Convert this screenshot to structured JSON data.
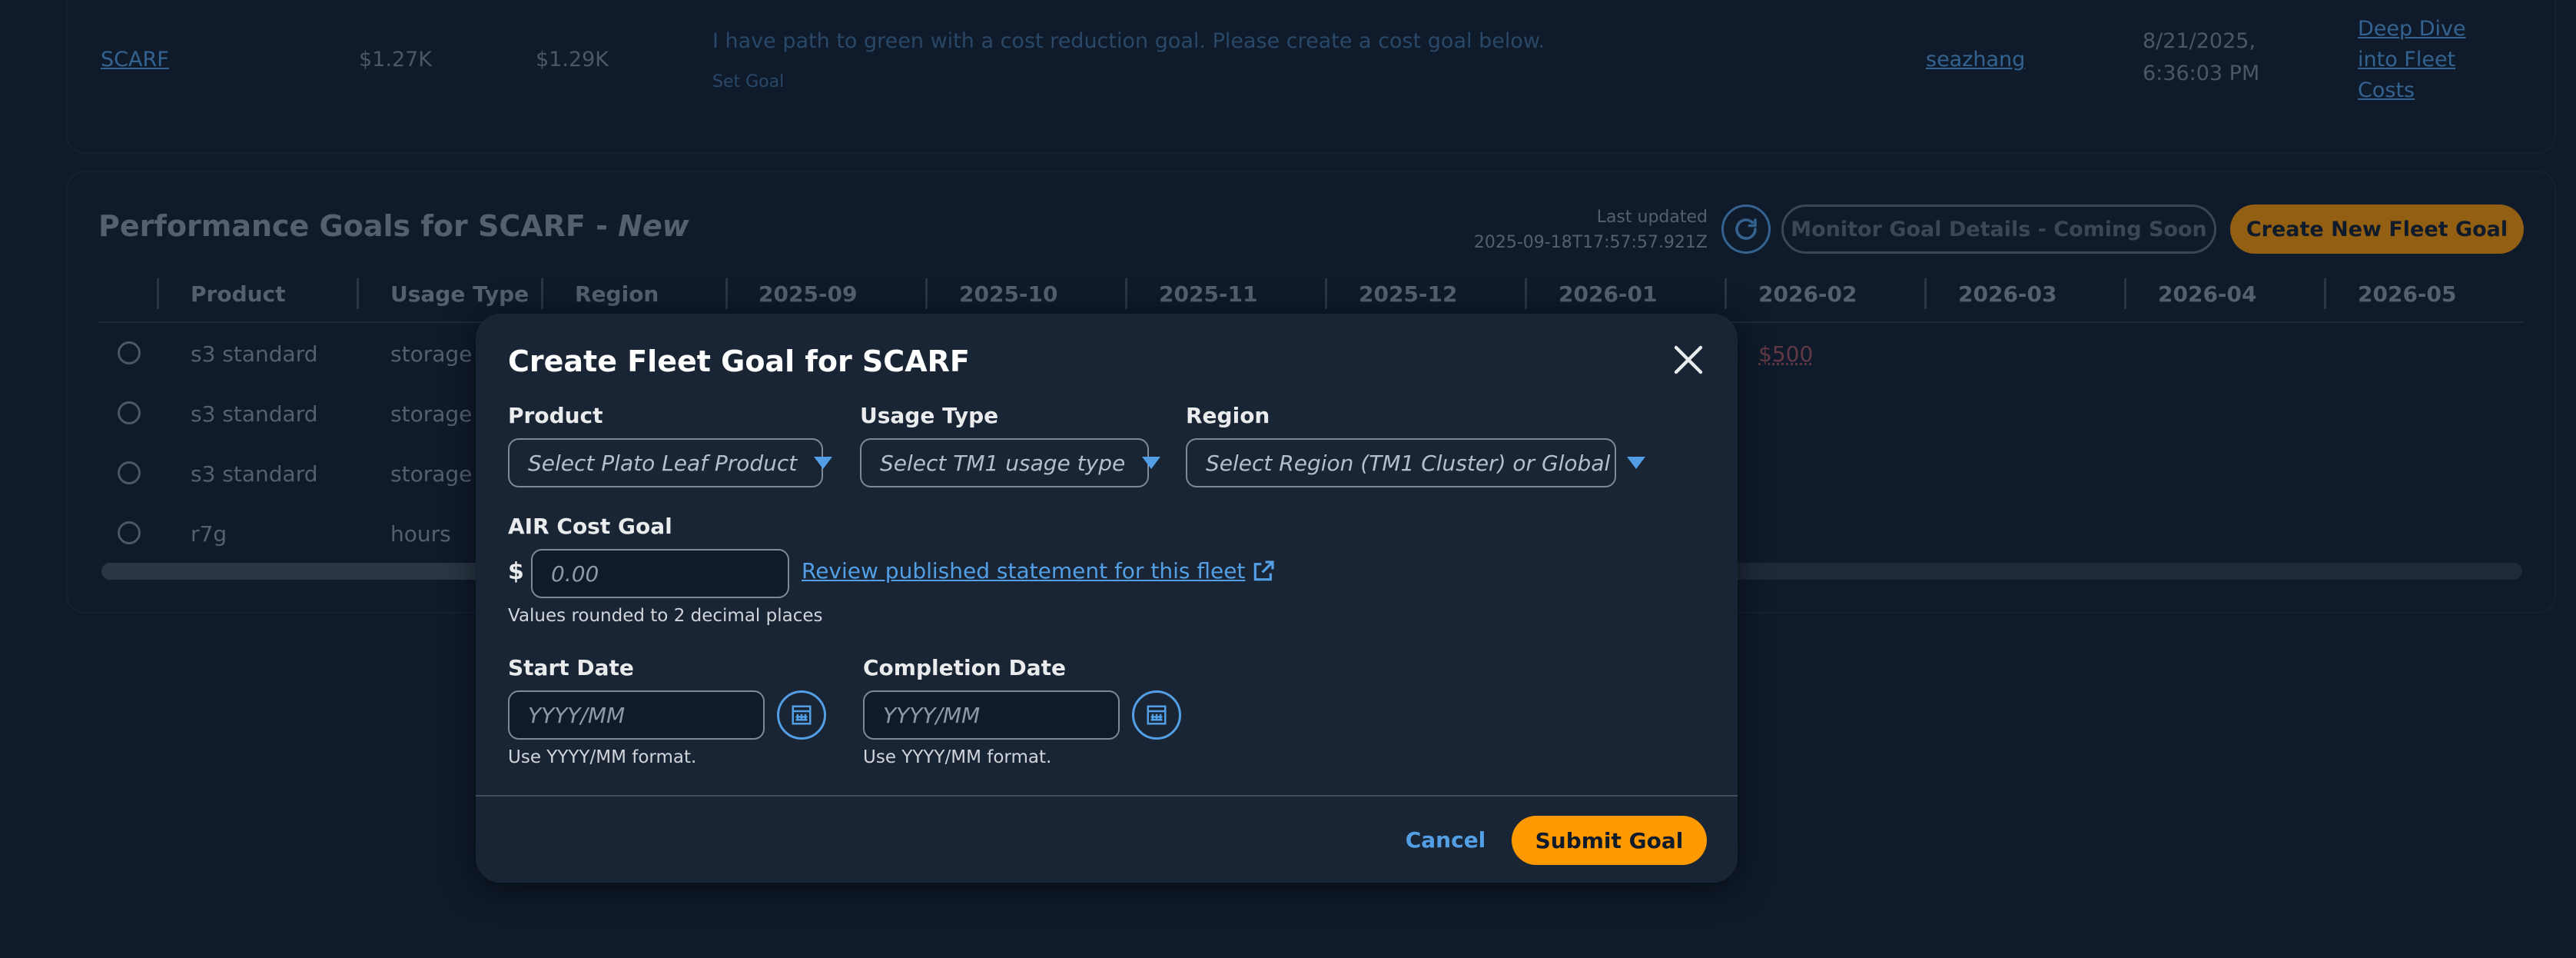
{
  "fleet_row": {
    "name": "SCARF",
    "cost_a": "$1.27K",
    "cost_b": "$1.29K",
    "message": "I have path to green with a cost reduction goal. Please create a cost goal below.",
    "set_goal": "Set Goal",
    "owner": "seazhang",
    "date_line1": "8/21/2025,",
    "date_line2": "6:36:03 PM",
    "deep_dive_1": "Deep Dive",
    "deep_dive_2": "into Fleet",
    "deep_dive_3": "Costs"
  },
  "perf": {
    "title": "Performance Goals for SCARF - ",
    "title_new": "New",
    "last_updated_label": "Last updated",
    "last_updated_value": "2025-09-18T17:57:57.921Z",
    "monitor_label": "Monitor Goal Details - Coming Soon",
    "create_label": "Create New Fleet Goal",
    "columns": [
      "Product",
      "Usage Type",
      "Region",
      "2025-09",
      "2025-10",
      "2025-11",
      "2025-12",
      "2026-01",
      "2026-02",
      "2026-03",
      "2026-04",
      "2026-05"
    ],
    "rows": [
      {
        "product": "s3 standard",
        "usage": "storage (",
        "value_2026_02": "$500"
      },
      {
        "product": "s3 standard",
        "usage": "storage ("
      },
      {
        "product": "s3 standard",
        "usage": "storage ("
      },
      {
        "product": "r7g",
        "usage": "hours"
      }
    ]
  },
  "modal": {
    "title": "Create Fleet Goal for SCARF",
    "product_label": "Product",
    "product_placeholder": "Select Plato Leaf Product",
    "usage_label": "Usage Type",
    "usage_placeholder": "Select TM1 usage type",
    "region_label": "Region",
    "region_placeholder": "Select Region (TM1 Cluster) or Global",
    "air_label": "AIR Cost Goal",
    "currency": "$",
    "air_placeholder": "0.00",
    "statement_link": "Review published statement for this fleet",
    "air_help": "Values rounded to 2 decimal places",
    "start_label": "Start Date",
    "start_placeholder": "YYYY/MM",
    "start_help": "Use YYYY/MM format.",
    "completion_label": "Completion Date",
    "completion_placeholder": "YYYY/MM",
    "completion_help": "Use YYYY/MM format.",
    "cancel_label": "Cancel",
    "submit_label": "Submit Goal"
  },
  "colors": {
    "accent": "#ff9900",
    "link": "#539fe5",
    "background": "#0f1b2a",
    "modal_bg": "#192534"
  },
  "icons": [
    "refresh-icon",
    "close-icon",
    "external-link-icon",
    "calendar-icon",
    "caret-down-icon"
  ]
}
